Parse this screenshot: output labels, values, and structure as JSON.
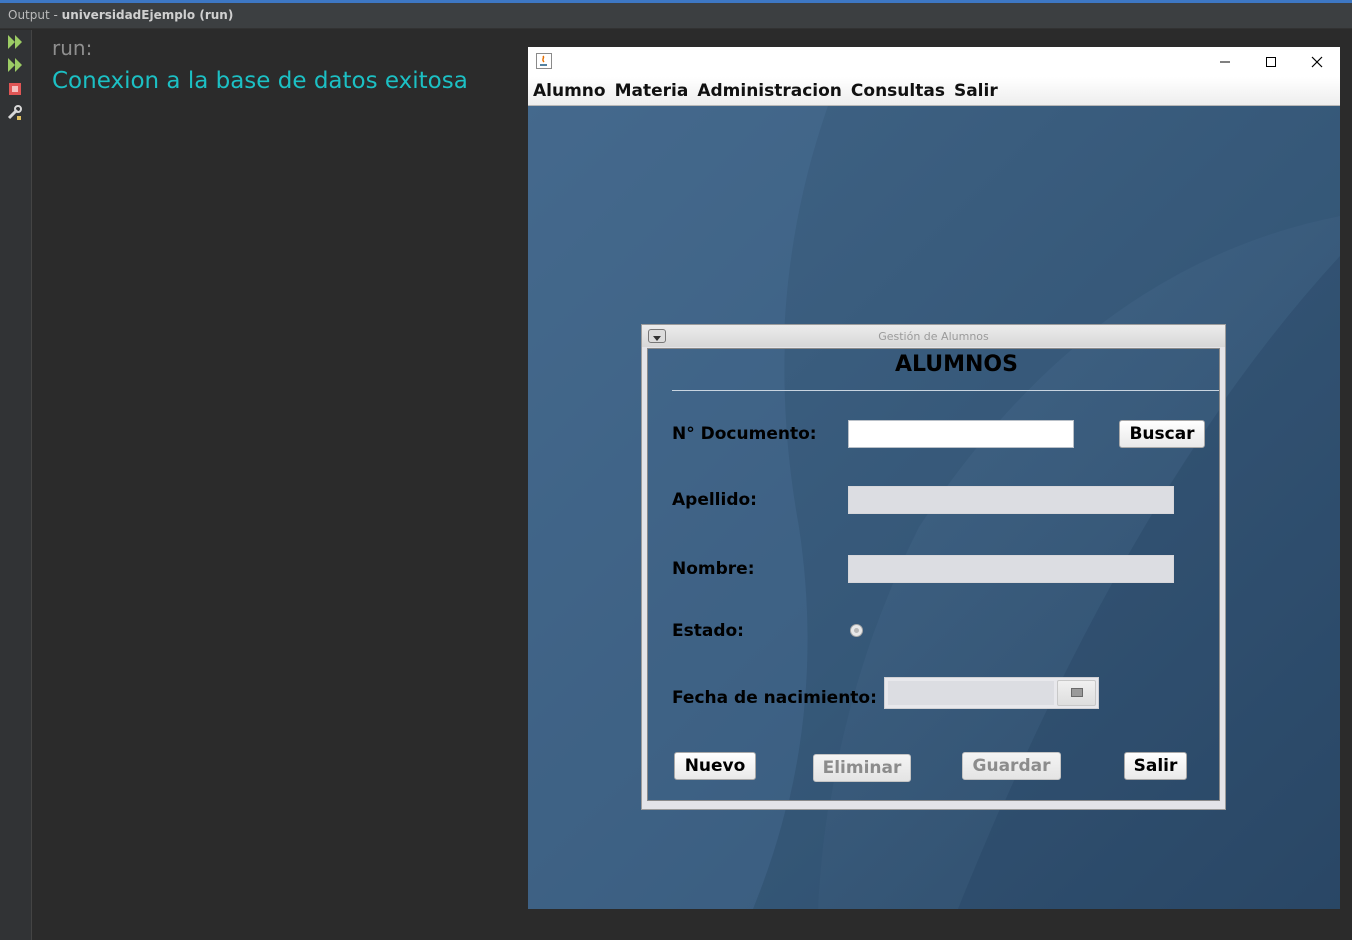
{
  "ide": {
    "output_prefix": "Output - ",
    "output_project": "universidadEjemplo (run)",
    "console_lines": [
      "run:",
      "Conexion a la base de datos exitosa"
    ],
    "gutter_icons": [
      "rerun-icon",
      "rerun-different-params-icon",
      "stop-icon",
      "settings-icon"
    ],
    "console_text_color": "#1cc0c4"
  },
  "app": {
    "window_buttons": [
      "minimize-icon",
      "maximize-icon",
      "close-icon"
    ],
    "menu": [
      "Alumno",
      "Materia",
      "Administracion",
      "Consultas",
      "Salir"
    ],
    "internal_frame": {
      "title": "Gestión de Alumnos",
      "heading": "ALUMNOS",
      "labels": {
        "documento": "N° Documento:",
        "apellido": "Apellido:",
        "nombre": "Nombre:",
        "estado": "Estado:",
        "fecha": "Fecha de nacimiento:"
      },
      "fields": {
        "documento": "",
        "apellido": "",
        "nombre": "",
        "fecha": ""
      },
      "buttons": {
        "buscar": "Buscar",
        "nuevo": "Nuevo",
        "eliminar": "Eliminar",
        "guardar": "Guardar",
        "salir": "Salir"
      }
    }
  }
}
